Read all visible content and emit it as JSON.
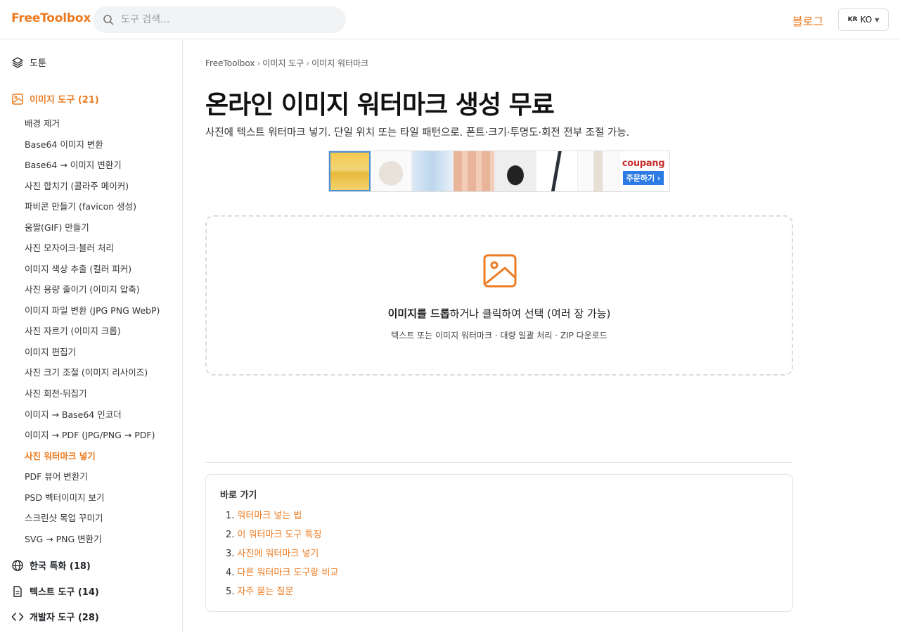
{
  "header": {
    "logo": "FreeToolbox",
    "search_placeholder": "도구 검색...",
    "blog_label": "블로그",
    "lang_flag": "KR",
    "lang_code": "KO"
  },
  "sidebar": {
    "top_label": "도툰",
    "categories": [
      {
        "label": "이미지 도구 (21)",
        "icon": "image-icon",
        "active": true
      },
      {
        "label": "한국 특화 (18)",
        "icon": "globe-icon"
      },
      {
        "label": "텍스트 도구 (14)",
        "icon": "document-icon"
      },
      {
        "label": "개발자 도구 (28)",
        "icon": "code-icon"
      }
    ],
    "image_tools": [
      "배경 제거",
      "Base64 이미지 변환",
      "Base64 → 이미지 변환기",
      "사진 합치기 (콜라주 메이커)",
      "파비콘 만들기 (favicon 생성)",
      "움짤(GIF) 만들기",
      "사진 모자이크·블러 처리",
      "이미지 색상 추출 (컬러 피커)",
      "사진 용량 줄이기 (이미지 압축)",
      "이미지 파일 변환 (JPG PNG WebP)",
      "사진 자르기 (이미지 크롭)",
      "이미지 편집기",
      "사진 크기 조절 (이미지 리사이즈)",
      "사진 회전·뒤집기",
      "이미지 → Base64 인코더",
      "이미지 → PDF (JPG/PNG → PDF)",
      "사진 워터마크 넣기",
      "PDF 뷰어 변환기",
      "PSD 벡터이미지 보기",
      "스크린샷 목업 꾸미기",
      "SVG → PNG 변환기"
    ],
    "active_tool": "사진 워터마크 넣기"
  },
  "main": {
    "breadcrumb": [
      "FreeToolbox",
      "이미지 도구",
      "이미지 워터마크"
    ],
    "breadcrumb_sep": "›",
    "title": "온라인 이미지 워터마크 생성 무료",
    "subtitle": "사진에 텍스트 워터마크 넣기. 단일 위치 또는 타일 패턴으로. 폰트·크기·투명도·회전 전부 조절 가능.",
    "ad": {
      "brand": "coupang",
      "cta": "주문하기 ›"
    },
    "dropzone": {
      "bold_text": "이미지를 드롭",
      "rest_text": "하거나 클릭하여 선택 (여러 장 가능)",
      "sub_text": "텍스트 또는 이미지 워터마크 · 대량 일괄 처리 · ZIP 다운로드"
    },
    "toc": {
      "title": "바로 가기",
      "items": [
        {
          "num": "1.",
          "label": "워터마크 넣는 법"
        },
        {
          "num": "2.",
          "label": "이 워터마크 도구 특징"
        },
        {
          "num": "3.",
          "label": "사진에 워터마크 넣기"
        },
        {
          "num": "4.",
          "label": "다른 워터마크 도구랑 비교"
        },
        {
          "num": "5.",
          "label": "자주 묻는 질문"
        }
      ]
    }
  },
  "colors": {
    "accent": "#ec7b21",
    "text": "#1f2328",
    "border": "#e7e7e7"
  }
}
